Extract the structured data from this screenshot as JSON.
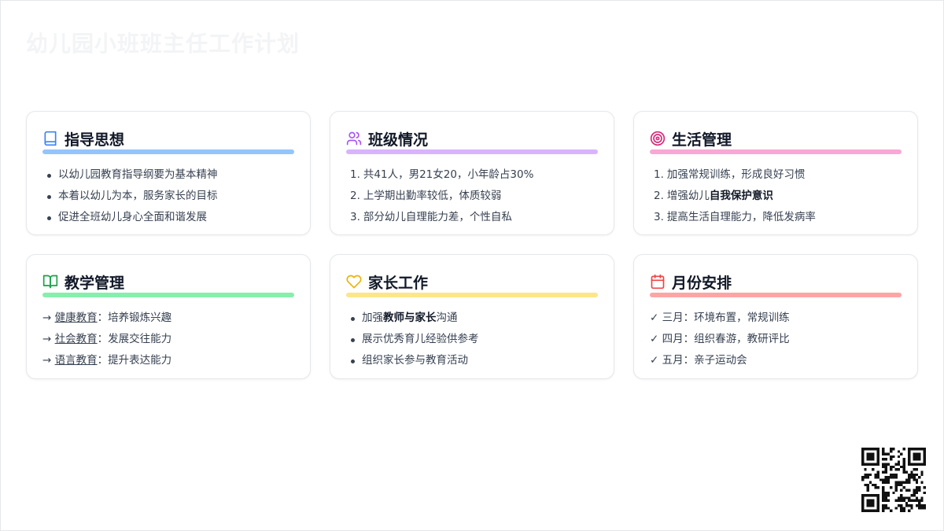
{
  "page": {
    "title": "幼儿园小班班主任工作计划"
  },
  "cards": [
    {
      "title": "指导思想",
      "icon": "book-icon",
      "accent": "#93c5fd",
      "iconColor": "#3b82f6",
      "items": [
        "以幼儿园教育指导纲要为基本精神",
        "本着以幼儿为本，服务家长的目标",
        "促进全班幼儿身心全面和谐发展"
      ]
    },
    {
      "title": "班级情况",
      "icon": "users-icon",
      "accent": "#d8b4fe",
      "iconColor": "#a855f7",
      "items": [
        {
          "num": "1.",
          "text": "共41人，男21女20，小年龄占30%"
        },
        {
          "num": "2.",
          "text": "上学期出勤率较低，体质较弱"
        },
        {
          "num": "3.",
          "text": "部分幼儿自理能力差，个性自私"
        }
      ]
    },
    {
      "title": "生活管理",
      "icon": "target-icon",
      "accent": "#f9a8d4",
      "iconColor": "#db2777",
      "items": [
        {
          "num": "1.",
          "text": "加强常规训练，形成良好习惯"
        },
        {
          "num": "2.",
          "pre": "增强幼儿",
          "bold": "自我保护意识"
        },
        {
          "num": "3.",
          "text": "提高生活自理能力，降低发病率"
        }
      ]
    },
    {
      "title": "教学管理",
      "icon": "open-book-icon",
      "accent": "#86efac",
      "iconColor": "#16a34a",
      "items": [
        {
          "arrow": "→",
          "link": "健康教育",
          "rest": "：培养锻炼兴趣"
        },
        {
          "arrow": "→",
          "link": "社会教育",
          "rest": "：发展交往能力"
        },
        {
          "arrow": "→",
          "link": "语言教育",
          "rest": "：提升表达能力"
        }
      ]
    },
    {
      "title": "家长工作",
      "icon": "heart-icon",
      "accent": "#fde68a",
      "iconColor": "#eab308",
      "items": [
        {
          "pre": "加强",
          "bold": "教师与家长",
          "post": "沟通"
        },
        {
          "text": "展示优秀育儿经验供参考"
        },
        {
          "text": "组织家长参与教育活动"
        }
      ]
    },
    {
      "title": "月份安排",
      "icon": "calendar-icon",
      "accent": "#fca5a5",
      "iconColor": "#ef4444",
      "items": [
        {
          "check": "✓",
          "text": "三月：环境布置，常规训练"
        },
        {
          "check": "✓",
          "text": "四月：组织春游，教研评比"
        },
        {
          "check": "✓",
          "text": "五月：亲子运动会"
        }
      ]
    }
  ]
}
